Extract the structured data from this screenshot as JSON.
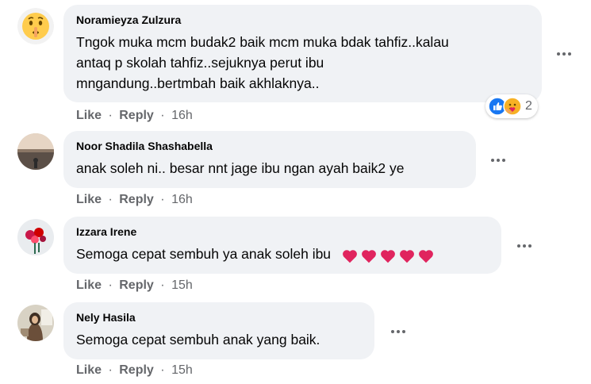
{
  "comments": [
    {
      "author": "Noramieyza Zulzura",
      "lines": [
        "Tngok muka mcm budak2 baik mcm muka bdak tahfiz..kalau",
        "antaq p skolah tahfiz..sejuknya perut ibu",
        "mngandung..bertmbah baik akhlaknya.."
      ],
      "like": "Like",
      "reply": "Reply",
      "time": "16h",
      "reaction_count": "2",
      "reactions": [
        "like-reaction-icon",
        "care-reaction-icon"
      ],
      "avatar": "shush-emoji-avatar"
    },
    {
      "author": "Noor Shadila Shashabella",
      "lines": [
        "anak soleh ni.. besar nnt jage ibu ngan ayah baik2 ye"
      ],
      "like": "Like",
      "reply": "Reply",
      "time": "16h",
      "avatar": "sunset-photo-avatar"
    },
    {
      "author": "Izzara Irene",
      "lines": [
        "Semoga cepat sembuh ya anak soleh ibu"
      ],
      "emoji": [
        "red-heart-icon",
        "red-heart-icon",
        "red-heart-icon",
        "red-heart-icon",
        "red-heart-icon"
      ],
      "like": "Like",
      "reply": "Reply",
      "time": "15h",
      "avatar": "roses-photo-avatar"
    },
    {
      "author": "Nely Hasila",
      "lines": [
        "Semoga cepat sembuh anak yang baik."
      ],
      "like": "Like",
      "reply": "Reply",
      "time": "15h",
      "avatar": "woman-hijab-photo-avatar"
    }
  ],
  "colors": {
    "bubble": "#f0f2f5",
    "secondary_text": "#65676b",
    "like_blue": "#1877f2",
    "heart_red": "#e0245e"
  }
}
